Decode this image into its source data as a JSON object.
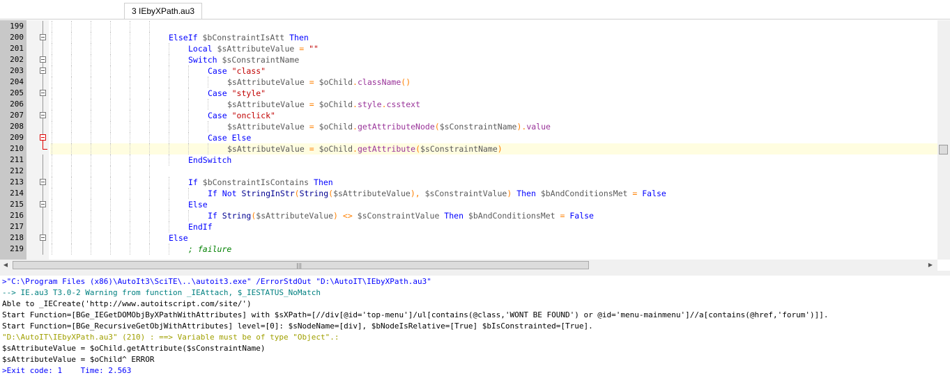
{
  "tab": {
    "label": "3 IEbyXPath.au3"
  },
  "editor": {
    "lines": [
      {
        "num": "199",
        "fold": "line",
        "indent": 6,
        "tokens": []
      },
      {
        "num": "200",
        "fold": "minus",
        "indent": 6,
        "tokens": [
          [
            "kw",
            "ElseIf "
          ],
          [
            "var",
            "$bConstraintIsAtt "
          ],
          [
            "kw",
            "Then"
          ]
        ]
      },
      {
        "num": "201",
        "fold": "line",
        "indent": 7,
        "tokens": [
          [
            "kw",
            "Local "
          ],
          [
            "var",
            "$sAttributeValue "
          ],
          [
            "op",
            "= "
          ],
          [
            "str",
            "\"\""
          ]
        ]
      },
      {
        "num": "202",
        "fold": "minus",
        "indent": 7,
        "tokens": [
          [
            "kw",
            "Switch "
          ],
          [
            "var",
            "$sConstraintName"
          ]
        ]
      },
      {
        "num": "203",
        "fold": "minus",
        "indent": 8,
        "tokens": [
          [
            "kw",
            "Case "
          ],
          [
            "str",
            "\"class\""
          ]
        ]
      },
      {
        "num": "204",
        "fold": "line",
        "indent": 9,
        "tokens": [
          [
            "var",
            "$sAttributeValue "
          ],
          [
            "op",
            "= "
          ],
          [
            "var",
            "$oChild"
          ],
          [
            "op",
            "."
          ],
          [
            "ob",
            "className"
          ],
          [
            "op",
            "()"
          ]
        ]
      },
      {
        "num": "205",
        "fold": "minus",
        "indent": 8,
        "tokens": [
          [
            "kw",
            "Case "
          ],
          [
            "str",
            "\"style\""
          ]
        ]
      },
      {
        "num": "206",
        "fold": "line",
        "indent": 9,
        "tokens": [
          [
            "var",
            "$sAttributeValue "
          ],
          [
            "op",
            "= "
          ],
          [
            "var",
            "$oChild"
          ],
          [
            "op",
            "."
          ],
          [
            "ob",
            "style"
          ],
          [
            "op",
            "."
          ],
          [
            "ob",
            "csstext"
          ]
        ]
      },
      {
        "num": "207",
        "fold": "minus",
        "indent": 8,
        "tokens": [
          [
            "kw",
            "Case "
          ],
          [
            "str",
            "\"onclick\""
          ]
        ]
      },
      {
        "num": "208",
        "fold": "line",
        "indent": 9,
        "tokens": [
          [
            "var",
            "$sAttributeValue "
          ],
          [
            "op",
            "= "
          ],
          [
            "var",
            "$oChild"
          ],
          [
            "op",
            "."
          ],
          [
            "ob",
            "getAttributeNode"
          ],
          [
            "op",
            "("
          ],
          [
            "var",
            "$sConstraintName"
          ],
          [
            "op",
            ")."
          ],
          [
            "ob",
            "value"
          ]
        ]
      },
      {
        "num": "209",
        "fold": "redminus",
        "indent": 8,
        "tokens": [
          [
            "kw",
            "Case Else"
          ]
        ]
      },
      {
        "num": "210",
        "fold": "redend",
        "indent": 9,
        "current": true,
        "tokens": [
          [
            "var",
            "$sAttributeValue "
          ],
          [
            "op",
            "= "
          ],
          [
            "var",
            "$oChild"
          ],
          [
            "op",
            "."
          ],
          [
            "ob",
            "getAttribute"
          ],
          [
            "op",
            "("
          ],
          [
            "var",
            "$sConstraintName"
          ],
          [
            "op",
            ")"
          ]
        ]
      },
      {
        "num": "211",
        "fold": "line",
        "indent": 7,
        "tokens": [
          [
            "kw",
            "EndSwitch"
          ]
        ]
      },
      {
        "num": "212",
        "fold": "line",
        "indent": 6,
        "tokens": []
      },
      {
        "num": "213",
        "fold": "minus",
        "indent": 7,
        "tokens": [
          [
            "kw",
            "If "
          ],
          [
            "var",
            "$bConstraintIsContains "
          ],
          [
            "kw",
            "Then"
          ]
        ]
      },
      {
        "num": "214",
        "fold": "line",
        "indent": 8,
        "tokens": [
          [
            "kw",
            "If Not "
          ],
          [
            "fn",
            "StringInStr"
          ],
          [
            "op",
            "("
          ],
          [
            "fn",
            "String"
          ],
          [
            "op",
            "("
          ],
          [
            "var",
            "$sAttributeValue"
          ],
          [
            "op",
            "), "
          ],
          [
            "var",
            "$sConstraintValue"
          ],
          [
            "op",
            ") "
          ],
          [
            "kw",
            "Then "
          ],
          [
            "var",
            "$bAndConditionsMet "
          ],
          [
            "op",
            "= "
          ],
          [
            "kw",
            "False"
          ]
        ]
      },
      {
        "num": "215",
        "fold": "minus",
        "indent": 7,
        "tokens": [
          [
            "kw",
            "Else"
          ]
        ]
      },
      {
        "num": "216",
        "fold": "line",
        "indent": 8,
        "tokens": [
          [
            "kw",
            "If "
          ],
          [
            "fn",
            "String"
          ],
          [
            "op",
            "("
          ],
          [
            "var",
            "$sAttributeValue"
          ],
          [
            "op",
            ") <> "
          ],
          [
            "var",
            "$sConstraintValue "
          ],
          [
            "kw",
            "Then "
          ],
          [
            "var",
            "$bAndConditionsMet "
          ],
          [
            "op",
            "= "
          ],
          [
            "kw",
            "False"
          ]
        ]
      },
      {
        "num": "217",
        "fold": "line",
        "indent": 7,
        "tokens": [
          [
            "kw",
            "EndIf"
          ]
        ]
      },
      {
        "num": "218",
        "fold": "minus",
        "indent": 6,
        "tokens": [
          [
            "kw",
            "Else"
          ]
        ]
      },
      {
        "num": "219",
        "fold": "line",
        "indent": 7,
        "tokens": [
          [
            "cm",
            "; failure"
          ]
        ]
      }
    ]
  },
  "output": {
    "lines": [
      {
        "color": "#0000ff",
        "text": ">\"C:\\Program Files (x86)\\AutoIt3\\SciTE\\..\\autoit3.exe\" /ErrorStdOut \"D:\\AutoIT\\IEbyXPath.au3\""
      },
      {
        "color": "#008080",
        "text": "--> IE.au3 T3.0-2 Warning from function _IEAttach, $_IESTATUS_NoMatch"
      },
      {
        "color": "#000000",
        "text": "Able to _IECreate('http://www.autoitscript.com/site/')"
      },
      {
        "color": "#000000",
        "text": "Start Function=[BGe_IEGetDOMObjByXPathWithAttributes] with $sXPath=[//div[@id='top-menu']/ul[contains(@class,'WONT BE FOUND') or @id='menu-mainmenu']//a[contains(@href,'forum')]]."
      },
      {
        "color": "#000000",
        "text": "Start Function=[BGe_RecursiveGetObjWithAttributes] level=[0]: $sNodeName=[div], $bNodeIsRelative=[True] $bIsConstrainted=[True]."
      },
      {
        "color": "#a0a000",
        "text": "\"D:\\AutoIT\\IEbyXPath.au3\" (210) : ==> Variable must be of type \"Object\".:"
      },
      {
        "color": "#000000",
        "text": "$sAttributeValue = $oChild.getAttribute($sConstraintName)"
      },
      {
        "color": "#000000",
        "text": "$sAttributeValue = $oChild^ ERROR"
      },
      {
        "color": "#0000ff",
        "text": ">Exit code: 1    Time: 2.563"
      }
    ]
  }
}
